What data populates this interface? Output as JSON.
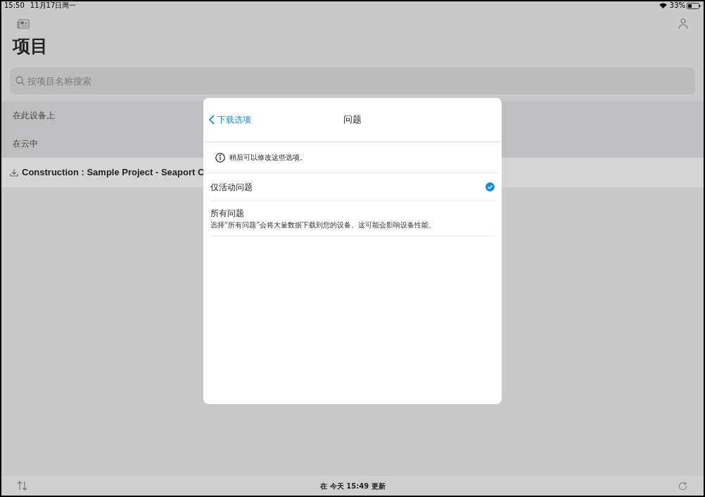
{
  "status_bar": {
    "time": "15:50",
    "date": "11月17日周一",
    "battery": "33%"
  },
  "page": {
    "title": "项目",
    "search": {
      "placeholder": "按项目名称搜索"
    },
    "sections": [
      {
        "label": "在此设备上"
      },
      {
        "label": "在云中"
      }
    ],
    "project_row": {
      "name": "Construction : Sample Project - Seaport C"
    }
  },
  "bottom_bar": {
    "sync_text": "在 今天 15:49 更新"
  },
  "dialog": {
    "back": "下载选项",
    "title": "问题",
    "note": "稍后可以修改这些选项。",
    "options": [
      {
        "label": "仅活动问题",
        "selected": true
      },
      {
        "label": "所有问题",
        "description": "选择“所有问题”会将大量数据下载到您的设备。这可能会影响设备性能。",
        "selected": false
      }
    ]
  }
}
